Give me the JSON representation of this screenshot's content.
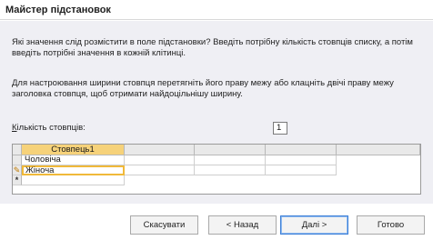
{
  "window": {
    "title": "Майстер підстановок"
  },
  "instructions": {
    "line1": "Які значення слід розмістити в поле підстановки? Введіть потрібну кількість стовпців списку, а потім введіть потрібні значення в кожній клітинці.",
    "line2": "Для настроювання ширини стовпця перетягніть його праву межу або клацніть двічі праву межу заголовка стовпця, щоб отримати найдоцільнішу ширину."
  },
  "column_count": {
    "label": "Кількість стовпців:",
    "value": "1"
  },
  "grid": {
    "column_header": "Стовпець1",
    "rows": [
      {
        "selector": "",
        "value": "Чоловіча"
      },
      {
        "selector": "✎",
        "value": "Жіноча"
      },
      {
        "selector": "*",
        "value": ""
      }
    ]
  },
  "buttons": {
    "cancel": "Скасувати",
    "back": "< Назад",
    "next": "Далі >",
    "finish": "Готово"
  }
}
